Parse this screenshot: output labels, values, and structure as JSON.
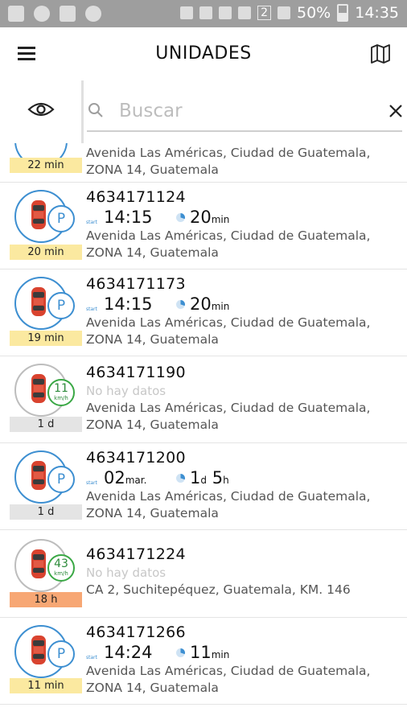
{
  "status_bar": {
    "battery": "50%",
    "time": "14:35",
    "sim": "2"
  },
  "app_bar": {
    "title": "UNIDADES",
    "menu_icon": "hamburger-menu-icon",
    "map_icon": "map-icon"
  },
  "search": {
    "placeholder": "Buscar",
    "value": "",
    "visibility_icon": "eye-icon",
    "search_icon": "search-icon",
    "clear_icon": "close-icon"
  },
  "colors": {
    "accent_blue": "#3d8fd1",
    "speed_green": "#3aa845",
    "tag_yellow": "#fbe9a0",
    "tag_grey": "#e4e4e4",
    "tag_orange": "#f7a774",
    "car_red": "#d9432f"
  },
  "units": [
    {
      "id": "",
      "status": "parked",
      "tag": "22 min",
      "address_line1": "Avenida Las Américas, Ciudad de Guatemala,",
      "address_line2": "ZONA 14, Guatemala"
    },
    {
      "id": "4634171124",
      "status": "parked",
      "tag": "20 min",
      "start_label": "start",
      "start_time": "14:15",
      "duration_main": "20",
      "duration_unit": "min",
      "address_line1": "Avenida Las Américas, Ciudad de Guatemala,",
      "address_line2": "ZONA 14, Guatemala"
    },
    {
      "id": "4634171173",
      "status": "parked",
      "tag": "19 min",
      "start_label": "start",
      "start_time": "14:15",
      "duration_main": "20",
      "duration_unit": "min",
      "address_line1": "Avenida Las Américas, Ciudad de Guatemala,",
      "address_line2": "ZONA 14, Guatemala"
    },
    {
      "id": "4634171190",
      "status": "moving",
      "speed": "11",
      "speed_unit": "km/h",
      "tag": "1 d",
      "no_data": "No hay datos",
      "address_line1": "Avenida Las Américas, Ciudad de Guatemala,",
      "address_line2": "ZONA 14, Guatemala"
    },
    {
      "id": "4634171200",
      "status": "parked",
      "tag": "1 d",
      "start_label": "start",
      "start_date_main": "02",
      "start_date_unit": "mar.",
      "duration_d": "1",
      "duration_d_unit": "d",
      "duration_h": "5",
      "duration_h_unit": "h",
      "address_line1": "Avenida Las Américas, Ciudad de Guatemala,",
      "address_line2": "ZONA 14, Guatemala"
    },
    {
      "id": "4634171224",
      "status": "moving",
      "speed": "43",
      "speed_unit": "km/h",
      "tag": "18 h",
      "no_data": "No hay datos",
      "address_line1": "CA 2, Suchitepéquez, Guatemala, KM. 146"
    },
    {
      "id": "4634171266",
      "status": "parked",
      "tag": "11 min",
      "start_label": "start",
      "start_time": "14:24",
      "duration_main": "11",
      "duration_unit": "min",
      "address_line1": "Avenida Las Américas, Ciudad de Guatemala,",
      "address_line2": "ZONA 14, Guatemala"
    }
  ]
}
